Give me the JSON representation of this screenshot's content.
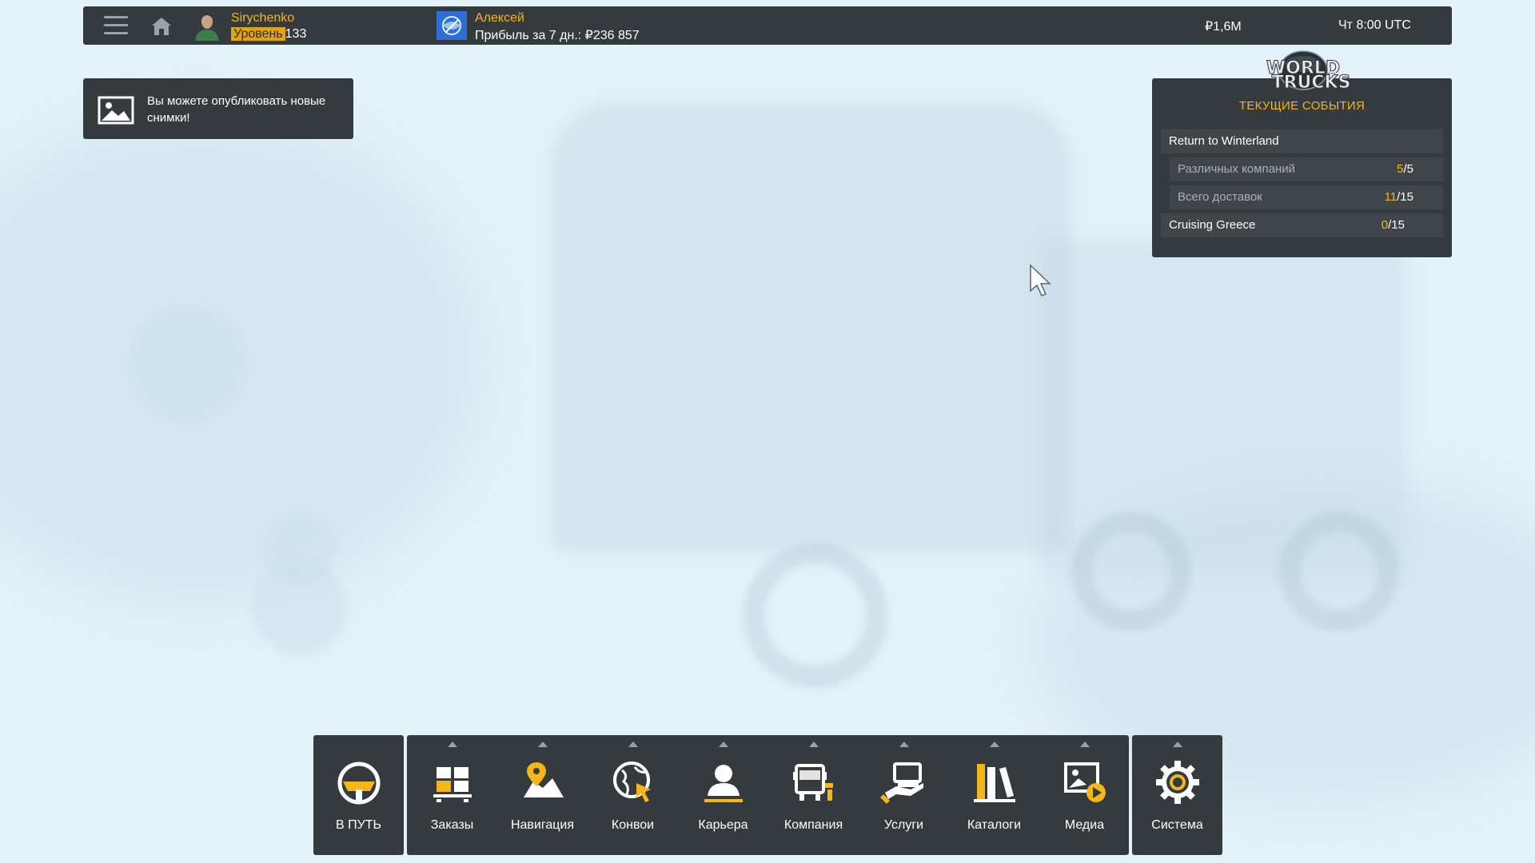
{
  "topbar": {
    "user_name": "Sirychenko",
    "level_label": "Уровень",
    "level_value": "133",
    "company_name": "Алексей",
    "company_profit": "Прибыль за 7 дн.: ₽236 857",
    "money": "₽1,6M",
    "clock": "Чт 8:00 UTC"
  },
  "notice": {
    "text": "Вы можете опубликовать новые снимки!"
  },
  "events": {
    "logo_text_1": "WORLD",
    "logo_text_2": "of",
    "logo_text_3": "TRUCKS",
    "title": "ТЕКУЩИЕ СОБЫТИЯ",
    "rows": [
      {
        "label": "Return to Winterland",
        "current": "",
        "total": ""
      },
      {
        "label": "Различных компаний",
        "current": "5",
        "total": "/5"
      },
      {
        "label": "Всего доставок",
        "current": "11",
        "total": "/15"
      },
      {
        "label": "Cruising Greece",
        "current": "0",
        "total": "/15"
      }
    ]
  },
  "dock": {
    "drive": "В ПУТЬ",
    "items": [
      {
        "label": "Заказы",
        "icon": "jobs-icon"
      },
      {
        "label": "Навигация",
        "icon": "navigation-icon"
      },
      {
        "label": "Конвои",
        "icon": "convoy-icon"
      },
      {
        "label": "Карьера",
        "icon": "career-icon"
      },
      {
        "label": "Компания",
        "icon": "company-icon"
      },
      {
        "label": "Услуги",
        "icon": "services-icon"
      },
      {
        "label": "Каталоги",
        "icon": "catalogs-icon"
      },
      {
        "label": "Медиа",
        "icon": "media-icon"
      }
    ],
    "system": "Система"
  },
  "colors": {
    "accent": "#f4b619",
    "panel": "#353a3f",
    "background": "#e3f1f8"
  }
}
